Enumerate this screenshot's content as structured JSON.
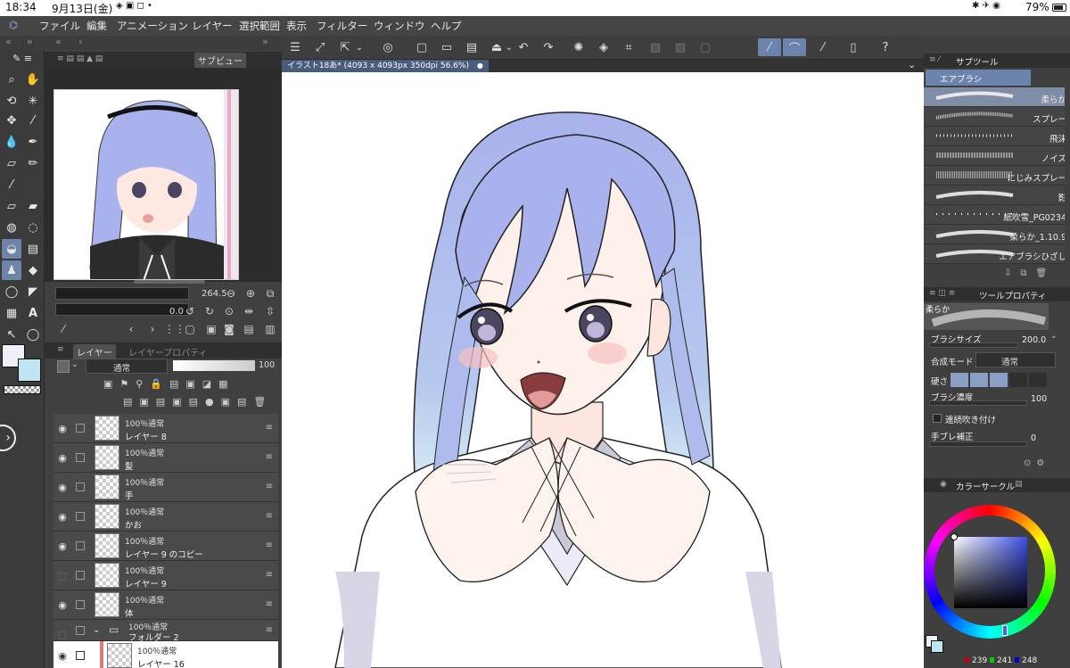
{
  "status_bar": {
    "time": "18:34",
    "date": "9月13日(金)",
    "battery": "79%"
  },
  "menu": {
    "items": [
      "ファイル",
      "編集",
      "アニメーション",
      "レイヤー",
      "選択範囲",
      "表示",
      "フィルター",
      "ウィンドウ",
      "ヘルプ"
    ]
  },
  "left_panels": {
    "nav_tabs": {
      "subview": "サブビュー"
    },
    "zoom_value": "264.5",
    "rotate_value": "0.0",
    "layer_tabs": {
      "layer": "レイヤー",
      "layer_property": "レイヤープロパティ"
    },
    "blend_mode": "通常",
    "opacity": "100",
    "layers": [
      {
        "mode": "100％通常",
        "name": "レイヤー 8",
        "selected": false
      },
      {
        "mode": "100％通常",
        "name": "髪",
        "selected": false
      },
      {
        "mode": "100％通常",
        "name": "手",
        "selected": false
      },
      {
        "mode": "100％通常",
        "name": "かお",
        "selected": false
      },
      {
        "mode": "100％通常",
        "name": "レイヤー 9 のコピー",
        "selected": false
      },
      {
        "mode": "100％通常",
        "name": "レイヤー 9",
        "selected": false
      },
      {
        "mode": "100％通常",
        "name": "体",
        "selected": false
      },
      {
        "mode": "100％通常",
        "name": "フォルダー 2",
        "selected": false,
        "folder": true
      },
      {
        "mode": "100％通常",
        "name": "レイヤー 16",
        "selected": true
      }
    ]
  },
  "document": {
    "tab_label": "イラスト18あ* (4093 x 4093px 350dpi 56.6%)"
  },
  "right_panels": {
    "subtool_tab": "サブツール",
    "subtool_group": "エアブラシ",
    "brushes": [
      "柔らか",
      "スプレー",
      "飛沫",
      "ノイズ",
      "にじみスプレー",
      "影",
      "紙吹雪_PG0234",
      "柔らか_1.10.9",
      "エアブラシひざし"
    ],
    "tool_property_tab": "ツールプロパティ",
    "current_brush": "柔らか",
    "brush_size_label": "ブラシサイズ",
    "brush_size_value": "200.0",
    "blend_label": "合成モード",
    "blend_value": "通常",
    "hardness_label": "硬さ",
    "density_label": "ブラシ濃度",
    "density_value": "100",
    "continuous_label": "連続吹き付け",
    "stabilization_label": "手ブレ補正",
    "stabilization_value": "0",
    "color_circle_tab": "カラーサークル",
    "rgb": {
      "r": "239",
      "g": "241",
      "b": "248"
    }
  },
  "colors": {
    "accent": "#6c84ad",
    "main_color": "#eff1f8",
    "sub_color": "#bfe4f2",
    "hair": "#a9b2ec"
  }
}
